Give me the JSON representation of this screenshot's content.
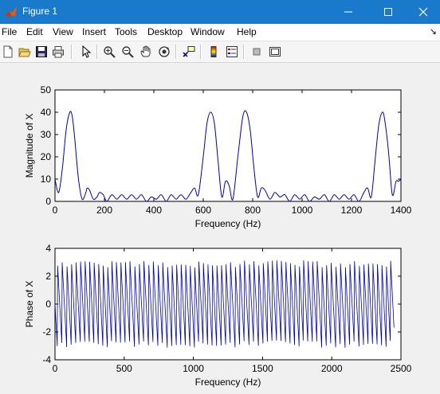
{
  "window": {
    "title": "Figure 1",
    "app_icon": "matlab-icon",
    "controls": [
      "minimize-icon",
      "maximize-icon",
      "close-icon"
    ]
  },
  "menubar": {
    "items": [
      "File",
      "Edit",
      "View",
      "Insert",
      "Tools",
      "Desktop",
      "Window",
      "Help"
    ],
    "dock_glyph": "↘"
  },
  "toolbar": {
    "buttons": [
      "new-figure-icon",
      "open-file-icon",
      "save-icon",
      "print-icon",
      "edit-plot-arrow-icon",
      "zoom-in-icon",
      "zoom-out-icon",
      "pan-hand-icon",
      "rotate-3d-icon",
      "data-cursor-icon",
      "insert-colorbar-icon",
      "insert-legend-icon",
      "hide-plot-tools-icon",
      "show-plot-tools-icon"
    ]
  },
  "colors": {
    "line": "#0000aa",
    "titlebar": "#1979ca"
  },
  "chart_data": [
    {
      "type": "line",
      "title": "",
      "xlabel": "Frequency (Hz)",
      "ylabel": "Magnitude of X",
      "xlim": [
        0,
        1400
      ],
      "ylim": [
        0,
        50
      ],
      "xticks": [
        0,
        200,
        400,
        600,
        800,
        1000,
        1200,
        1400
      ],
      "yticks": [
        0,
        10,
        20,
        30,
        40,
        50
      ],
      "grid": false,
      "series": [
        {
          "x": [
            0,
            15,
            30,
            45,
            60,
            70,
            80,
            95,
            110,
            125,
            130,
            140,
            155,
            170,
            180,
            195,
            210,
            230,
            250,
            270,
            290,
            310,
            330,
            350,
            370,
            390,
            410,
            430,
            450,
            470,
            490,
            510,
            530,
            550,
            565,
            580,
            600,
            615,
            630,
            645,
            660,
            675,
            690,
            705,
            720,
            740,
            760,
            775,
            790,
            805,
            820,
            835,
            850,
            870,
            890,
            910,
            930,
            950,
            970,
            990,
            1010,
            1030,
            1050,
            1070,
            1090,
            1110,
            1130,
            1150,
            1170,
            1190,
            1210,
            1230,
            1250,
            1265,
            1280,
            1295,
            1310,
            1325,
            1335,
            1350,
            1365,
            1380,
            1390,
            1400
          ],
          "y": [
            10,
            4,
            15,
            32,
            40,
            38,
            28,
            10,
            1,
            4,
            6,
            5,
            1,
            2,
            4,
            3,
            0,
            3,
            1,
            3,
            1,
            3,
            1,
            3,
            0,
            2,
            1,
            3,
            0,
            3,
            1,
            3,
            1,
            4,
            6,
            3,
            20,
            35,
            40,
            35,
            18,
            2,
            9,
            7,
            1,
            20,
            38,
            40,
            32,
            15,
            2,
            6,
            5,
            1,
            4,
            2,
            3,
            0,
            3,
            1,
            3,
            0,
            2,
            1,
            3,
            0,
            3,
            1,
            3,
            1,
            3,
            0,
            4,
            6,
            2,
            18,
            34,
            40,
            36,
            22,
            3,
            9,
            9,
            10
          ]
        }
      ]
    },
    {
      "type": "line",
      "title": "",
      "xlabel": "Frequency (Hz)",
      "ylabel": "Phase of X",
      "xlim": [
        0,
        2500
      ],
      "ylim": [
        -4,
        4
      ],
      "xticks": [
        0,
        500,
        1000,
        1500,
        2000,
        2500
      ],
      "yticks": [
        -4,
        -2,
        0,
        2,
        4
      ],
      "grid": false,
      "series": [
        {
          "pattern": "sawtooth wrapped phase between -pi and pi",
          "x_range": [
            0,
            2450
          ],
          "y_range": [
            -3.14,
            3.14
          ]
        }
      ]
    }
  ]
}
